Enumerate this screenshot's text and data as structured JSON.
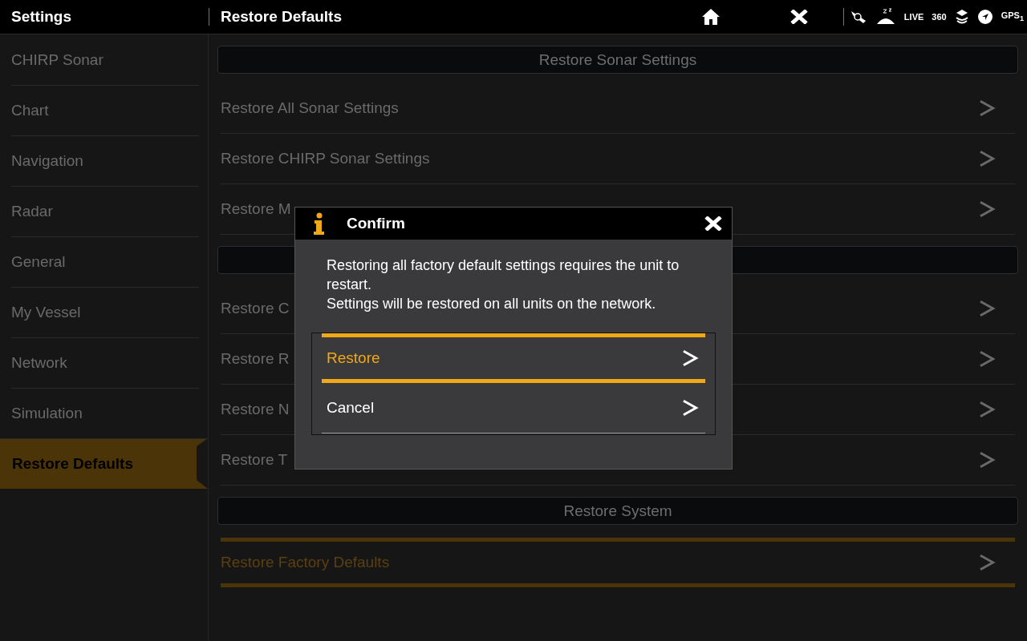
{
  "header": {
    "title": "Settings",
    "page_title": "Restore Defaults"
  },
  "status": {
    "live": "LIVE",
    "degrees": "360",
    "gps": "GPS",
    "gps_count": "1"
  },
  "sidebar": {
    "items": [
      {
        "label": "CHIRP Sonar",
        "selected": false
      },
      {
        "label": "Chart",
        "selected": false
      },
      {
        "label": "Navigation",
        "selected": false
      },
      {
        "label": "Radar",
        "selected": false
      },
      {
        "label": "General",
        "selected": false
      },
      {
        "label": "My Vessel",
        "selected": false
      },
      {
        "label": "Network",
        "selected": false
      },
      {
        "label": "Simulation",
        "selected": false
      },
      {
        "label": "Restore Defaults",
        "selected": true
      }
    ]
  },
  "list": [
    {
      "kind": "header",
      "label": "Restore Sonar Settings"
    },
    {
      "kind": "row",
      "label": "Restore All Sonar Settings",
      "selected": false
    },
    {
      "kind": "row",
      "label": "Restore CHIRP Sonar Settings",
      "selected": false
    },
    {
      "kind": "row",
      "label": "Restore M",
      "selected": false
    },
    {
      "kind": "header"
    },
    {
      "kind": "row",
      "label": "Restore C",
      "selected": false
    },
    {
      "kind": "row",
      "label": "Restore R",
      "selected": false
    },
    {
      "kind": "row",
      "label": "Restore N",
      "selected": false
    },
    {
      "kind": "row",
      "label": "Restore T",
      "selected": false
    },
    {
      "kind": "header",
      "label": "Restore System"
    },
    {
      "kind": "row",
      "label": "Restore Factory Defaults",
      "selected": true
    }
  ],
  "dialog": {
    "title": "Confirm",
    "message": "Restoring all factory default settings requires the unit to restart.\nSettings will be restored on all units on the network.",
    "options": [
      {
        "label": "Restore",
        "selected": true
      },
      {
        "label": "Cancel",
        "selected": false
      }
    ]
  }
}
